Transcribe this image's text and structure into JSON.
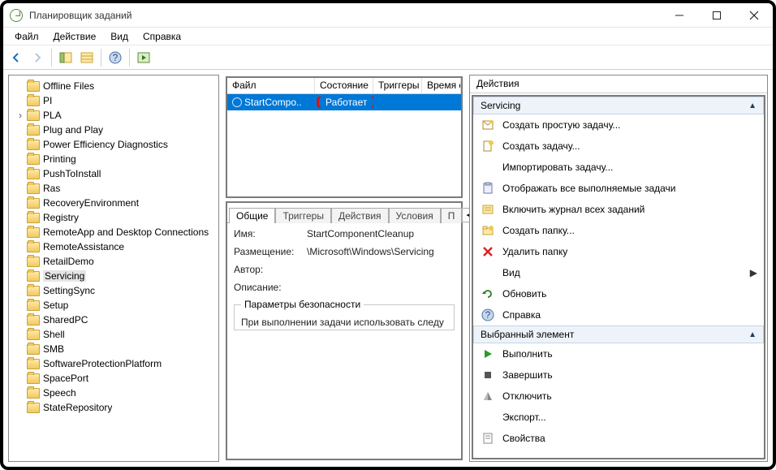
{
  "title": "Планировщик заданий",
  "menu": {
    "file": "Файл",
    "action": "Действие",
    "view": "Вид",
    "help": "Справка"
  },
  "tree": [
    {
      "label": "Offline Files"
    },
    {
      "label": "PI"
    },
    {
      "label": "PLA",
      "arrow": true
    },
    {
      "label": "Plug and Play"
    },
    {
      "label": "Power Efficiency Diagnostics"
    },
    {
      "label": "Printing"
    },
    {
      "label": "PushToInstall"
    },
    {
      "label": "Ras"
    },
    {
      "label": "RecoveryEnvironment"
    },
    {
      "label": "Registry"
    },
    {
      "label": "RemoteApp and Desktop Connections"
    },
    {
      "label": "RemoteAssistance"
    },
    {
      "label": "RetailDemo"
    },
    {
      "label": "Servicing",
      "selected": true
    },
    {
      "label": "SettingSync"
    },
    {
      "label": "Setup"
    },
    {
      "label": "SharedPC"
    },
    {
      "label": "Shell"
    },
    {
      "label": "SMB"
    },
    {
      "label": "SoftwareProtectionPlatform"
    },
    {
      "label": "SpacePort"
    },
    {
      "label": "Speech"
    },
    {
      "label": "StateRepository"
    }
  ],
  "list": {
    "columns": {
      "file": "Файл",
      "state": "Состояние",
      "triggers": "Триггеры",
      "next": "Время сл"
    },
    "row": {
      "file": "StartCompo..",
      "state": "Работает"
    }
  },
  "tabs": {
    "general": "Общие",
    "triggers": "Триггеры",
    "actions": "Действия",
    "conditions": "Условия",
    "more": "П"
  },
  "details": {
    "name_label": "Имя:",
    "name_value": "StartComponentCleanup",
    "loc_label": "Размещение:",
    "loc_value": "\\Microsoft\\Windows\\Servicing",
    "author_label": "Автор:",
    "desc_label": "Описание:",
    "sec_group": "Параметры безопасности",
    "sec_line": "При выполнении задачи использовать следу"
  },
  "actions_panel": {
    "header": "Действия",
    "section1": "Servicing",
    "items1": [
      {
        "icon": "wizard",
        "label": "Создать простую задачу..."
      },
      {
        "icon": "new",
        "label": "Создать задачу..."
      },
      {
        "icon": "none",
        "label": "Импортировать задачу..."
      },
      {
        "icon": "clipboard",
        "label": "Отображать все выполняемые задачи"
      },
      {
        "icon": "log",
        "label": "Включить журнал всех заданий"
      },
      {
        "icon": "newfolder",
        "label": "Создать папку..."
      },
      {
        "icon": "delete",
        "label": "Удалить папку"
      },
      {
        "icon": "none",
        "label": "Вид",
        "more": true
      },
      {
        "icon": "refresh",
        "label": "Обновить"
      },
      {
        "icon": "help",
        "label": "Справка"
      }
    ],
    "section2": "Выбранный элемент",
    "items2": [
      {
        "icon": "run",
        "label": "Выполнить"
      },
      {
        "icon": "stop",
        "label": "Завершить"
      },
      {
        "icon": "disable",
        "label": "Отключить"
      },
      {
        "icon": "none",
        "label": "Экспорт..."
      },
      {
        "icon": "props",
        "label": "Свойства"
      }
    ]
  }
}
